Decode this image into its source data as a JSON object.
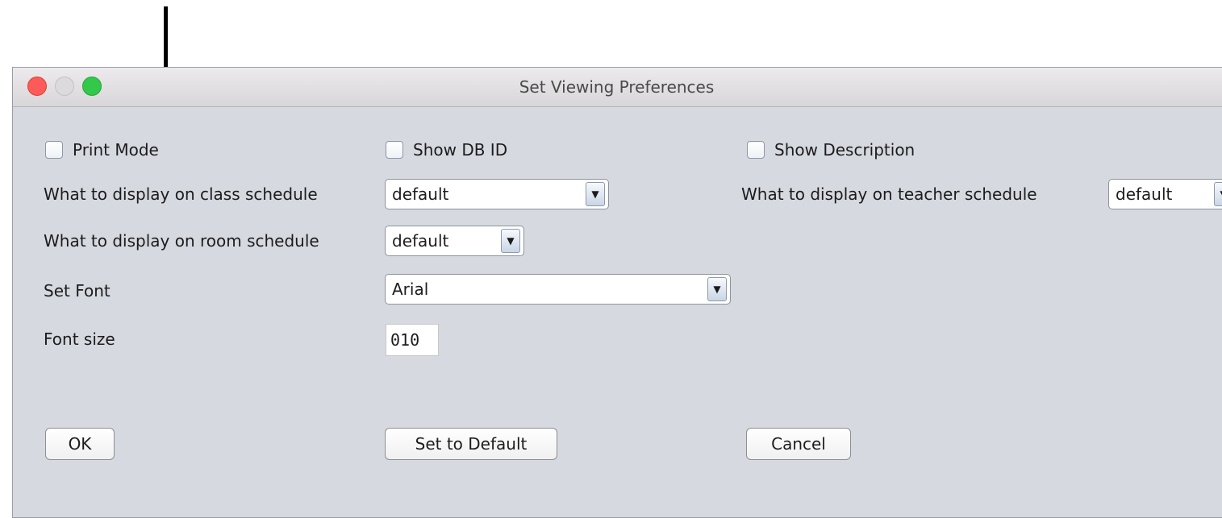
{
  "window": {
    "title": "Set Viewing Preferences"
  },
  "checkboxes": [
    {
      "label": "Print Mode",
      "checked": false
    },
    {
      "label": "Show DB ID",
      "checked": false
    },
    {
      "label": "Show Description",
      "checked": false
    }
  ],
  "class_schedule": {
    "label": "What to display on class schedule",
    "value": "default"
  },
  "teacher_schedule": {
    "label": "What to display on teacher schedule",
    "value": "default"
  },
  "room_schedule": {
    "label": "What to display on room schedule",
    "value": "default"
  },
  "font": {
    "label": "Set Font",
    "value": "Arial"
  },
  "font_size": {
    "label": "Font size",
    "value": "010"
  },
  "buttons": {
    "ok": "OK",
    "default": "Set to Default",
    "cancel": "Cancel"
  },
  "colors": {
    "close": "#fc5b57",
    "minimize": "#dcdadc",
    "zoom": "#34c84a",
    "window_bg": "#d6d9e0"
  }
}
